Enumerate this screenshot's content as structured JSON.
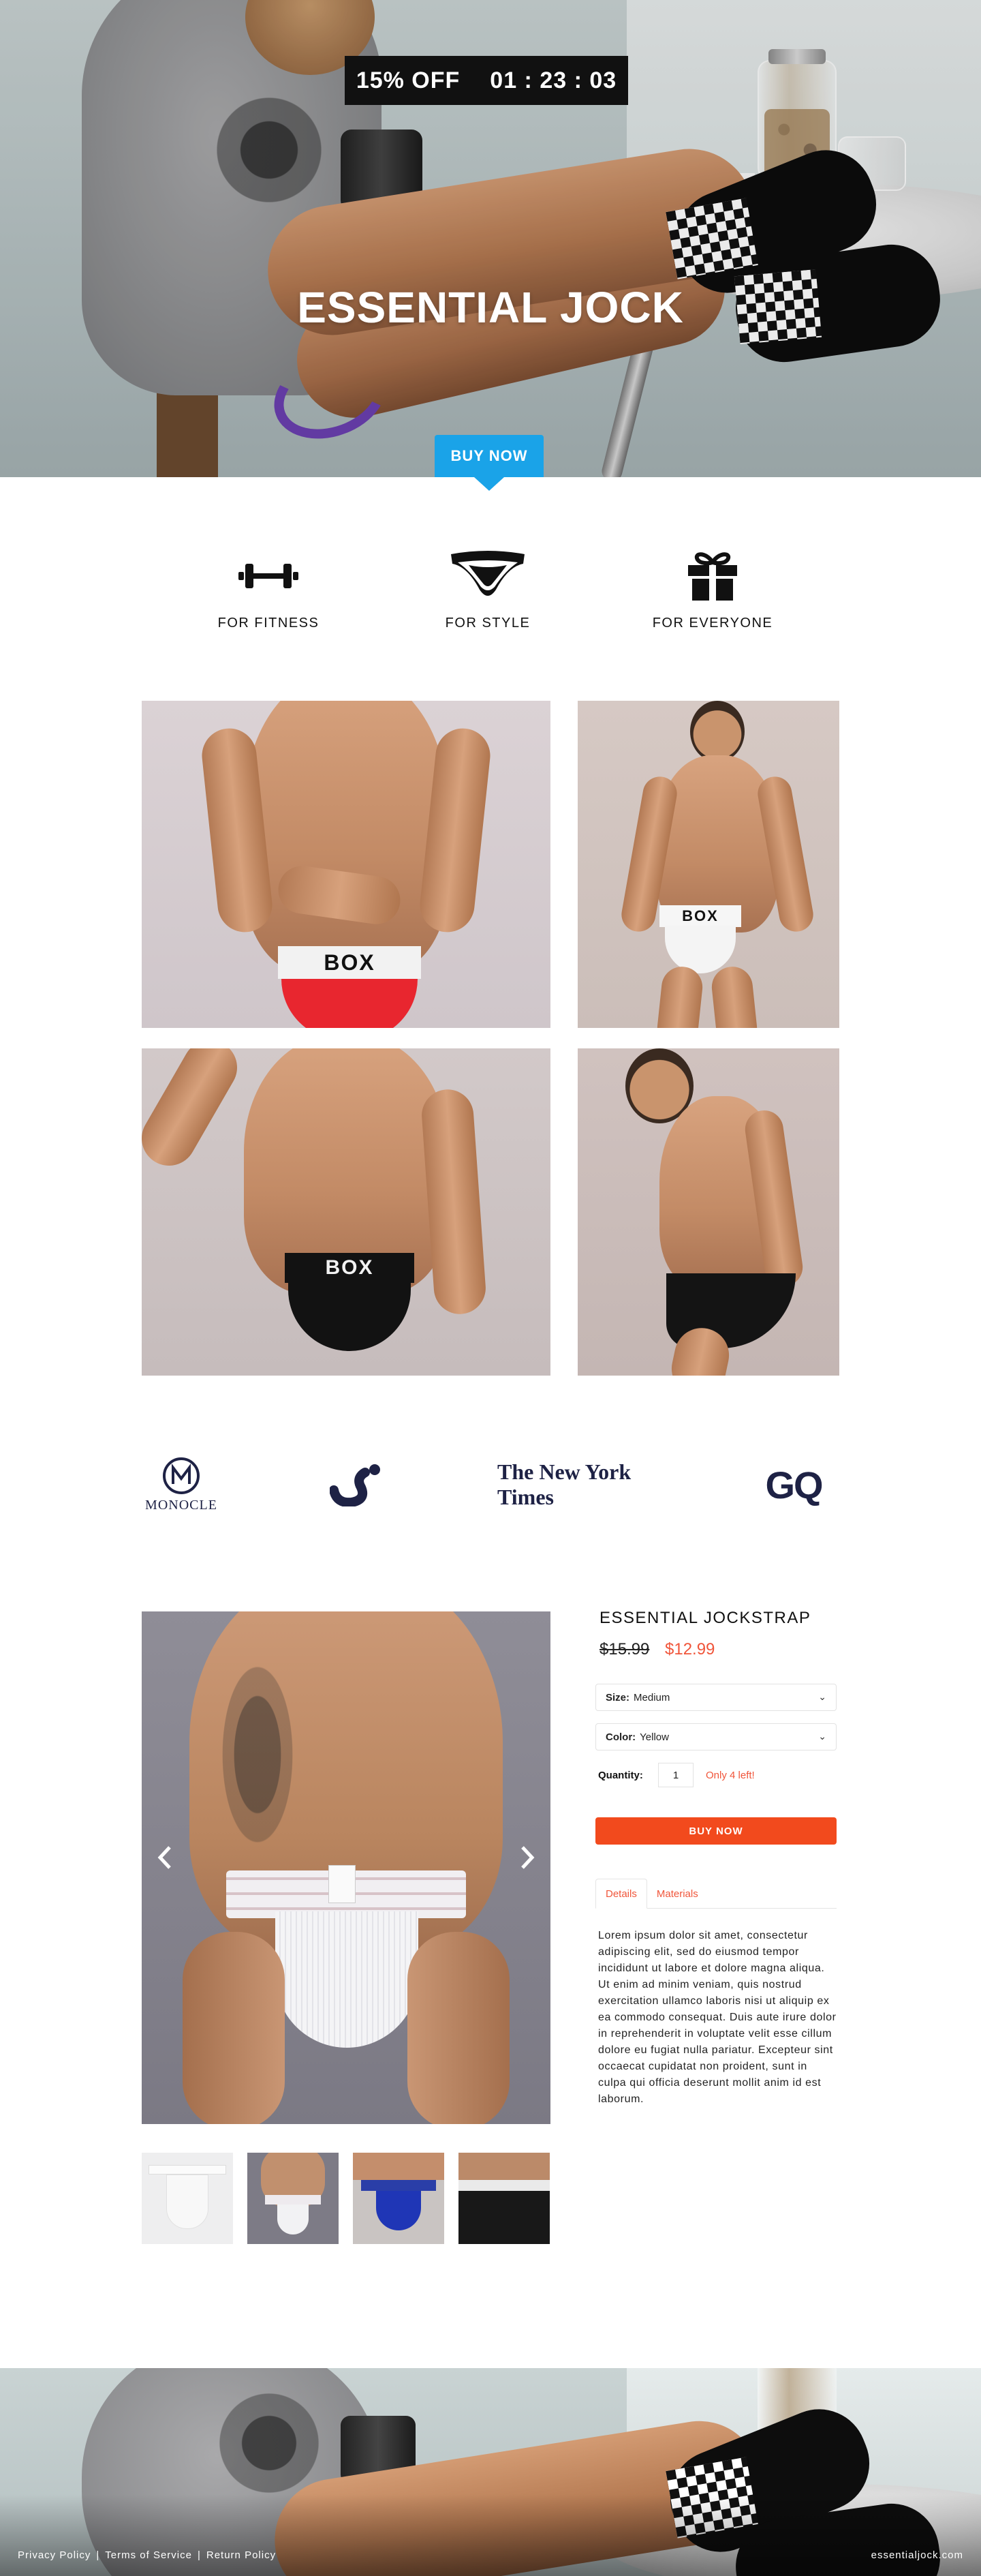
{
  "hero": {
    "promo": "15% OFF",
    "countdown": "01 : 23 : 03",
    "title": "ESSENTIAL JOCK",
    "cta": "BUY NOW"
  },
  "features": [
    {
      "label": "FOR FITNESS",
      "icon": "dumbbell-icon"
    },
    {
      "label": "FOR STYLE",
      "icon": "jockstrap-icon"
    },
    {
      "label": "FOR EVERYONE",
      "icon": "gift-icon"
    }
  ],
  "gallery": {
    "waistband_text": [
      "BOX",
      "BOX",
      "BOX"
    ],
    "colors": {
      "red": "#e8262f",
      "white": "#f4f4f4",
      "black": "#121212"
    }
  },
  "press": {
    "monocle": "MONOCLE",
    "nyt": "The New York Times",
    "gq": "GQ"
  },
  "product": {
    "title": "ESSENTIAL JOCKSTRAP",
    "old_price": "$15.99",
    "new_price": "$12.99",
    "size_label": "Size:",
    "size_value": "Medium",
    "color_label": "Color:",
    "color_value": "Yellow",
    "quantity_label": "Quantity:",
    "quantity_value": "1",
    "stock_text": "Only 4 left!",
    "buy_label": "BUY NOW",
    "tabs": [
      "Details",
      "Materials"
    ],
    "description": "Lorem ipsum dolor sit amet, consectetur adipiscing elit, sed do eiusmod tempor incididunt ut labore et dolore magna aliqua. Ut enim ad minim veniam, quis nostrud exercitation ullamco laboris nisi ut aliquip ex ea commodo consequat. Duis aute irure dolor in reprehenderit in voluptate velit esse cillum dolore eu fugiat nulla pariatur. Excepteur sint occaecat cupidatat non proident, sunt in culpa qui officia deserunt mollit anim id est laborum.",
    "accent": "#f24a1d"
  },
  "footer": {
    "links": [
      "Privacy Policy",
      "Terms of Service",
      "Return Policy"
    ],
    "separator": "|",
    "domain": "essentialjock.com"
  }
}
